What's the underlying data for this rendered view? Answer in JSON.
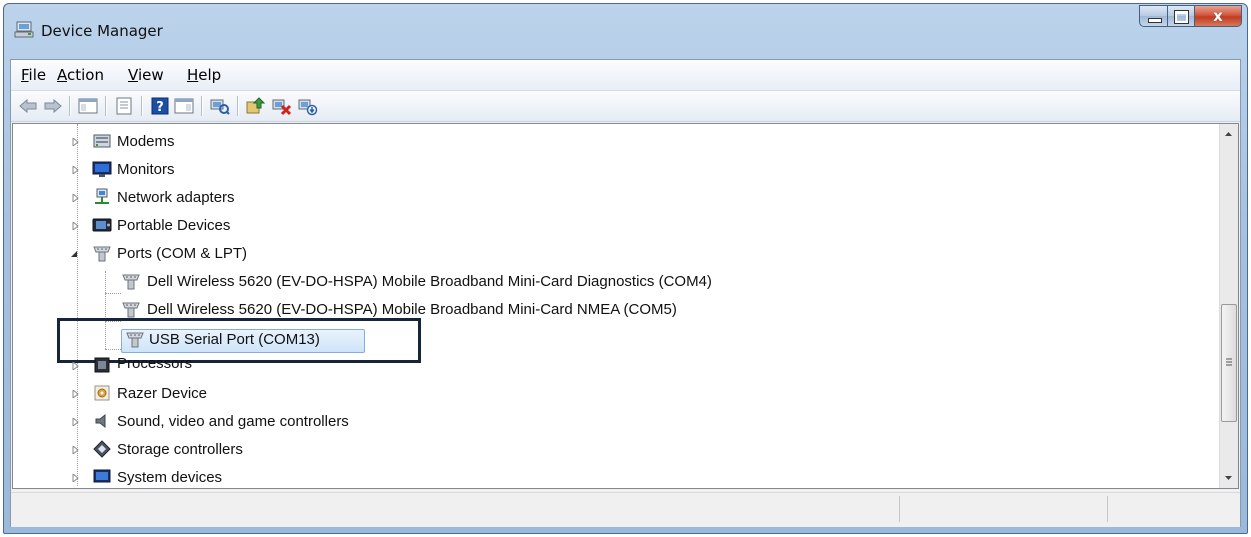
{
  "window": {
    "title": "Device Manager"
  },
  "menubar": {
    "items": [
      {
        "accel": "F",
        "rest": "ile"
      },
      {
        "accel": "A",
        "rest": "ction"
      },
      {
        "accel": "V",
        "rest": "iew"
      },
      {
        "accel": "H",
        "rest": "elp"
      }
    ]
  },
  "toolbar": {
    "icons": [
      "back-arrow-icon",
      "forward-arrow-icon",
      "show-hide-console-tree-icon",
      "properties-icon",
      "help-icon",
      "show-action-pane-icon",
      "scan-hardware-changes-icon",
      "update-driver-icon",
      "uninstall-icon",
      "disable-device-icon"
    ]
  },
  "tree": {
    "categories": [
      {
        "label": "Modems",
        "icon": "modem-icon",
        "expanded": false
      },
      {
        "label": "Monitors",
        "icon": "monitor-icon",
        "expanded": false
      },
      {
        "label": "Network adapters",
        "icon": "network-adapter-icon",
        "expanded": false
      },
      {
        "label": "Portable Devices",
        "icon": "portable-device-icon",
        "expanded": false
      },
      {
        "label": "Ports (COM & LPT)",
        "icon": "port-icon",
        "expanded": true
      },
      {
        "label": "Processors",
        "icon": "processor-icon",
        "expanded": false
      },
      {
        "label": "Razer Device",
        "icon": "razer-device-icon",
        "expanded": false
      },
      {
        "label": "Sound, video and game controllers",
        "icon": "speaker-icon",
        "expanded": false
      },
      {
        "label": "Storage controllers",
        "icon": "storage-controller-icon",
        "expanded": false
      },
      {
        "label": "System devices",
        "icon": "system-device-icon",
        "expanded": false
      }
    ],
    "ports_children": [
      {
        "label": "Dell Wireless 5620 (EV-DO-HSPA) Mobile Broadband Mini-Card Diagnostics (COM4)",
        "selected": false
      },
      {
        "label": "Dell Wireless 5620 (EV-DO-HSPA) Mobile Broadband Mini-Card NMEA (COM5)",
        "selected": false
      },
      {
        "label": "USB Serial Port (COM13)",
        "selected": true
      }
    ]
  },
  "colors": {
    "selection_border": "#84acdd",
    "highlight_box": "#17253a",
    "close_button": "#c13b21"
  }
}
